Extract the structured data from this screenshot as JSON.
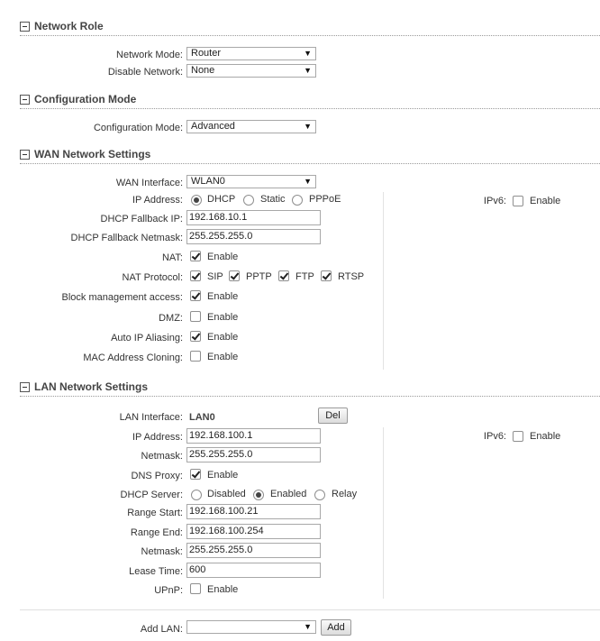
{
  "network_role": {
    "title": "Network Role",
    "network_mode": {
      "label": "Network Mode:",
      "value": "Router"
    },
    "disable_network": {
      "label": "Disable Network:",
      "value": "None"
    }
  },
  "config_mode": {
    "title": "Configuration Mode",
    "mode": {
      "label": "Configuration Mode:",
      "value": "Advanced"
    }
  },
  "wan": {
    "title": "WAN Network Settings",
    "interface": {
      "label": "WAN Interface:",
      "value": "WLAN0"
    },
    "ip_address": {
      "label": "IP Address:",
      "options": [
        "DHCP",
        "Static",
        "PPPoE"
      ],
      "selected": "DHCP"
    },
    "ipv6": {
      "label": "IPv6:",
      "enable": "Enable",
      "checked": false
    },
    "dhcp_fallback_ip": {
      "label": "DHCP Fallback IP:",
      "value": "192.168.10.1"
    },
    "dhcp_fallback_netmask": {
      "label": "DHCP Fallback Netmask:",
      "value": "255.255.255.0"
    },
    "nat": {
      "label": "NAT:",
      "enable": "Enable",
      "checked": true
    },
    "nat_protocol": {
      "label": "NAT Protocol:",
      "items": [
        "SIP",
        "PPTP",
        "FTP",
        "RTSP"
      ]
    },
    "block_mgmt": {
      "label": "Block management access:",
      "enable": "Enable",
      "checked": true
    },
    "dmz": {
      "label": "DMZ:",
      "enable": "Enable",
      "checked": false
    },
    "auto_ip": {
      "label": "Auto IP Aliasing:",
      "enable": "Enable",
      "checked": true
    },
    "mac_clone": {
      "label": "MAC Address Cloning:",
      "enable": "Enable",
      "checked": false
    }
  },
  "lan": {
    "title": "LAN Network Settings",
    "interface": {
      "label": "LAN Interface:",
      "value": "LAN0",
      "del": "Del"
    },
    "ipv6": {
      "label": "IPv6:",
      "enable": "Enable",
      "checked": false
    },
    "ip_address": {
      "label": "IP Address:",
      "value": "192.168.100.1"
    },
    "netmask": {
      "label": "Netmask:",
      "value": "255.255.255.0"
    },
    "dns_proxy": {
      "label": "DNS Proxy:",
      "enable": "Enable",
      "checked": true
    },
    "dhcp_server": {
      "label": "DHCP Server:",
      "options": [
        "Disabled",
        "Enabled",
        "Relay"
      ],
      "selected": "Enabled"
    },
    "range_start": {
      "label": "Range Start:",
      "value": "192.168.100.21"
    },
    "range_end": {
      "label": "Range End:",
      "value": "192.168.100.254"
    },
    "dhcp_netmask": {
      "label": "Netmask:",
      "value": "255.255.255.0"
    },
    "lease_time": {
      "label": "Lease Time:",
      "value": "600"
    },
    "upnp": {
      "label": "UPnP:",
      "enable": "Enable",
      "checked": false
    }
  },
  "add_lan": {
    "label": "Add LAN:",
    "value": "",
    "button": "Add"
  }
}
